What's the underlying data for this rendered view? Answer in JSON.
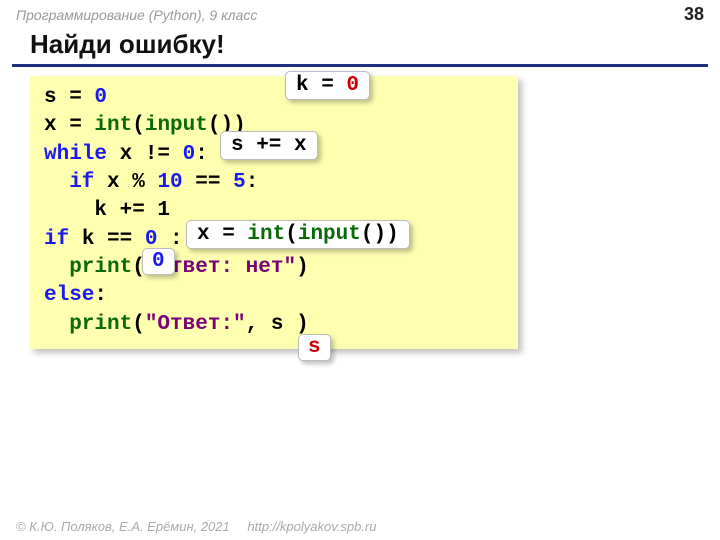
{
  "header": {
    "course": "Программирование (Python), 9 класс",
    "page": "38"
  },
  "title": "Найди ошибку!",
  "code": {
    "l1_a": "s",
    "l1_b": " = ",
    "l1_c": "0",
    "l2_a": "x = ",
    "l2_b": "int",
    "l2_c": "(",
    "l2_d": "input",
    "l2_e": "())",
    "l3_a": "while",
    "l3_b": " x != ",
    "l3_c": "0",
    "l3_d": ":",
    "l4_a": "  if",
    "l4_b": " x % ",
    "l4_c": "10",
    "l4_d": " == ",
    "l4_e": "5",
    "l4_f": ":",
    "l5": "    k += 1",
    "l6_a": "if",
    "l6_b": " k == ",
    "l6_c": "0",
    "l6_d": " :",
    "l7_a": "  print",
    "l7_b": "(",
    "l7_c": "\"Ответ: нет\"",
    "l7_d": ")",
    "l8_a": "else",
    "l8_b": ":",
    "l9_a": "  print",
    "l9_b": "(",
    "l9_c": "\"Ответ:\"",
    "l9_d": ", ",
    "l9_e": "s",
    "l9_f": " )"
  },
  "overlays": {
    "ke0_a": "k = ",
    "ke0_b": "0",
    "sx": "s += x",
    "xii_a": "x = ",
    "xii_b": "int",
    "xii_c": "(",
    "xii_d": "input",
    "xii_e": "())",
    "zero": "0",
    "s": "s"
  },
  "footer": {
    "copyright": "© К.Ю. Поляков, Е.А. Ерёмин, 2021",
    "link": "http://kpolyakov.spb.ru"
  }
}
